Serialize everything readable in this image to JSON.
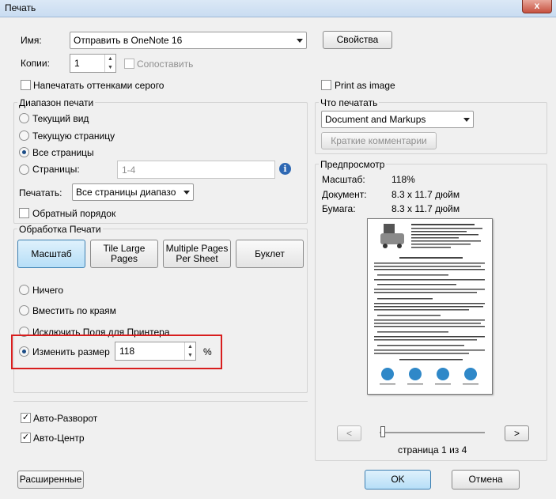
{
  "window": {
    "title": "Печать",
    "close_glyph": "x"
  },
  "printer": {
    "name_label": "Имя:",
    "name_value": "Отправить в OneNote 16",
    "properties_button": "Свойства",
    "copies_label": "Копии:",
    "copies_value": "1",
    "collate_label": "Сопоставить",
    "grayscale_label": "Напечатать оттенками серого",
    "print_as_image_label": "Print as image"
  },
  "range": {
    "title": "Диапазон печати",
    "options": [
      "Текущий вид",
      "Текущую страницу",
      "Все страницы",
      "Страницы:"
    ],
    "pages_value": "1-4",
    "print_label": "Печатать:",
    "print_value": "Все страницы диапазо",
    "reverse_label": "Обратный порядок"
  },
  "handling": {
    "title": "Обработка Печати",
    "buttons": [
      "Масштаб",
      "Tile Large Pages",
      "Multiple Pages Per Sheet",
      "Буклет"
    ],
    "options": [
      "Ничего",
      "Вместить по краям",
      "Исключить Поля для Принтера",
      "Изменить размер"
    ],
    "resize_value": "118",
    "percent_sign": "%"
  },
  "auto": {
    "rotate_label": "Авто-Разворот",
    "center_label": "Авто-Центр"
  },
  "what": {
    "title": "Что печатать",
    "value": "Document and Markups",
    "summarize_button": "Краткие комментарии"
  },
  "preview": {
    "title": "Предпросмотр",
    "scale_label": "Масштаб:",
    "scale_value": "118%",
    "document_label": "Документ:",
    "document_value": "8.3 x 11.7 дюйм",
    "paper_label": "Бумага:",
    "paper_value": "8.3 x 11.7 дюйм",
    "prev_glyph": "<",
    "next_glyph": ">",
    "page_status": "страница 1 из 4"
  },
  "footer": {
    "advanced_button": "Расширенные",
    "ok_button": "OK",
    "cancel_button": "Отмена"
  }
}
